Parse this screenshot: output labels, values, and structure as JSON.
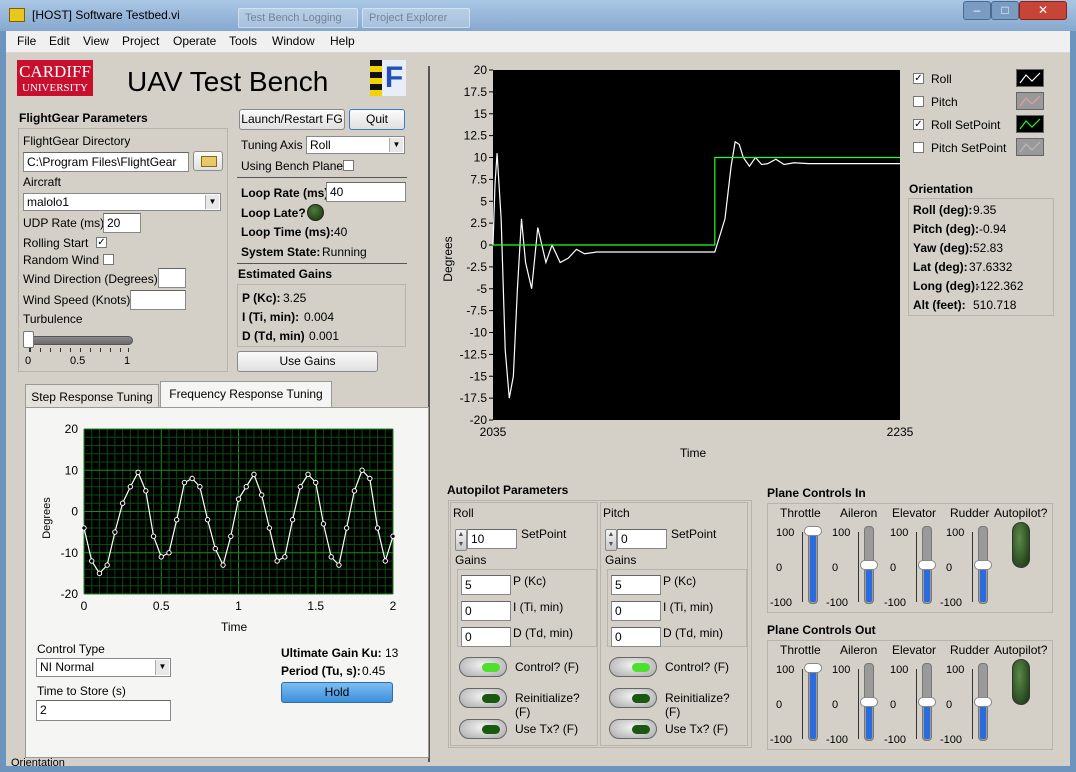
{
  "window": {
    "title": "[HOST] Software Testbed.vi",
    "ghost_tabs": [
      "Test Bench Logging",
      "Project Explorer"
    ]
  },
  "menu": [
    "File",
    "Edit",
    "View",
    "Project",
    "Operate",
    "Tools",
    "Window",
    "Help"
  ],
  "header": {
    "logo_line1": "CARDIFF",
    "logo_line2": "UNIVERSITY",
    "title": "UAV Test Bench",
    "fg_logo": "F"
  },
  "fg_params": {
    "section_title": "FlightGear Parameters",
    "dir_label": "FlightGear Directory",
    "dir_value": "C:\\Program Files\\FlightGear",
    "aircraft_label": "Aircraft",
    "aircraft_value": "malolo1",
    "udp_label": "UDP Rate (ms)",
    "udp_value": "20",
    "rolling_label": "Rolling Start",
    "rolling_checked": true,
    "random_wind_label": "Random Wind",
    "random_wind_checked": false,
    "wind_dir_label": "Wind Direction (Degrees)",
    "wind_dir_value": "",
    "wind_speed_label": "Wind Speed (Knots)",
    "wind_speed_value": "",
    "turbulence_label": "Turbulence",
    "turbulence_ticks": [
      "0",
      "0.5",
      "1"
    ],
    "turbulence_value": 0
  },
  "controls": {
    "launch_label": "Launch/Restart FG",
    "quit_label": "Quit",
    "tuning_axis_label": "Tuning Axis",
    "tuning_axis_value": "Roll",
    "bench_plane_label": "Using Bench Plane",
    "bench_plane_checked": false,
    "loop_rate_label": "Loop Rate (ms)",
    "loop_rate_value": "40",
    "loop_late_label": "Loop Late?",
    "loop_time_label": "Loop Time (ms):",
    "loop_time_value": "40",
    "system_state_label": "System State:",
    "system_state_value": "Running",
    "est_gains_title": "Estimated Gains",
    "p_label": "P (Kc):",
    "p_value": "3.25",
    "i_label": "I (Ti, min):",
    "i_value": "0.004",
    "d_label": "D (Td, min)",
    "d_value": "0.001",
    "use_gains_label": "Use Gains"
  },
  "main_chart": {
    "ylabel": "Degrees",
    "xlabel": "Time",
    "x_tick_labels": [
      "2035",
      "2235"
    ],
    "y_tick_labels": [
      "20",
      "17.5",
      "15",
      "12.5",
      "10",
      "7.5",
      "5",
      "2.5",
      "0",
      "-2.5",
      "-5",
      "-7.5",
      "-10",
      "-12.5",
      "-15",
      "-17.5",
      "-20"
    ]
  },
  "legend": [
    {
      "label": "Roll",
      "checked": true,
      "color": "#ffffff"
    },
    {
      "label": "Pitch",
      "checked": false,
      "color": "#e0a0a0"
    },
    {
      "label": "Roll SetPoint",
      "checked": true,
      "color": "#22ff22"
    },
    {
      "label": "Pitch SetPoint",
      "checked": false,
      "color": "#bbbbbb"
    }
  ],
  "orientation": {
    "title": "Orientation",
    "rows": [
      {
        "label": "Roll (deg):",
        "value": "9.35"
      },
      {
        "label": "Pitch (deg):",
        "value": "-0.94"
      },
      {
        "label": "Yaw (deg):",
        "value": "52.83"
      },
      {
        "label": "Lat (deg):",
        "value": "37.6332"
      },
      {
        "label": "Long (deg):",
        "value": "-122.362"
      },
      {
        "label": "Alt (feet):",
        "value": "510.718"
      }
    ]
  },
  "tabs": {
    "step_label": "Step Response Tuning",
    "freq_label": "Frequency Response Tuning"
  },
  "freq_chart": {
    "ylabel": "Degrees",
    "xlabel": "Time",
    "x_tick_labels": [
      "0",
      "0.5",
      "1",
      "1.5",
      "2"
    ],
    "y_tick_labels": [
      "20",
      "10",
      "0",
      "-10",
      "-20"
    ]
  },
  "freq_panel": {
    "control_type_label": "Control Type",
    "control_type_value": "NI Normal",
    "time_store_label": "Time to Store (s)",
    "time_store_value": "2",
    "ku_label": "Ultimate Gain Ku:",
    "ku_value": "13",
    "period_label": "Period (Tu, s):",
    "period_value": "0.45",
    "hold_label": "Hold",
    "bottom_cut_label": "Orientation"
  },
  "autopilot": {
    "title": "Autopilot Parameters",
    "setpoint_label": "SetPoint",
    "gains_label": "Gains",
    "p_label": "P (Kc)",
    "i_label": "I (Ti, min)",
    "d_label": "D (Td, min)",
    "control_label": "Control? (F)",
    "reinit_label": "Reinitialize? (F)",
    "usetx_label": "Use Tx? (F)",
    "roll": {
      "title": "Roll",
      "setpoint": "10",
      "p": "5",
      "i": "0",
      "d": "0",
      "control_on": true
    },
    "pitch": {
      "title": "Pitch",
      "setpoint": "0",
      "p": "5",
      "i": "0",
      "d": "0",
      "control_on": true
    }
  },
  "plane_in": {
    "title": "Plane Controls In",
    "labels": [
      "Throttle",
      "Aileron",
      "Elevator",
      "Rudder",
      "Autopilot?"
    ],
    "scale": [
      "100",
      "0",
      "-100"
    ],
    "values": [
      100,
      0,
      0,
      0
    ]
  },
  "plane_out": {
    "title": "Plane Controls Out",
    "labels": [
      "Throttle",
      "Aileron",
      "Elevator",
      "Rudder",
      "Autopilot?"
    ],
    "scale": [
      "100",
      "0",
      "-100"
    ],
    "values": [
      100,
      0,
      0,
      0
    ]
  },
  "chart_data": [
    {
      "type": "line",
      "xlabel": "Time",
      "ylabel": "Degrees",
      "xlim": [
        2035,
        2235
      ],
      "ylim": [
        -20,
        20
      ],
      "series": [
        {
          "name": "Roll",
          "x": [
            2035,
            2036,
            2037,
            2039,
            2041,
            2043,
            2045,
            2047,
            2049,
            2051,
            2054,
            2057,
            2061,
            2064,
            2068,
            2072,
            2076,
            2080,
            2086,
            2100,
            2120,
            2144,
            2149,
            2152,
            2154,
            2156,
            2158,
            2161,
            2164,
            2167,
            2170,
            2174,
            2178,
            2183,
            2190,
            2200,
            2235
          ],
          "y": [
            0,
            7,
            10.5,
            3,
            -12,
            -17.5,
            -15,
            -5,
            3,
            -2,
            -5,
            2,
            -2,
            0,
            -2,
            -1.5,
            -0.5,
            -1,
            -0.8,
            -0.8,
            -0.8,
            -0.8,
            3,
            9,
            11.8,
            11.5,
            10,
            9,
            10,
            9.2,
            9.3,
            9.8,
            9.2,
            9.4,
            9.3,
            9.3,
            9.3
          ]
        },
        {
          "name": "Roll SetPoint",
          "x": [
            2035,
            2144,
            2144,
            2235
          ],
          "y": [
            0,
            0,
            10,
            10
          ]
        }
      ]
    },
    {
      "type": "line",
      "xlabel": "Time",
      "ylabel": "Degrees",
      "xlim": [
        0,
        2
      ],
      "ylim": [
        -20,
        20
      ],
      "series": [
        {
          "name": "",
          "x": [
            0,
            0.05,
            0.1,
            0.15,
            0.2,
            0.25,
            0.3,
            0.35,
            0.4,
            0.45,
            0.5,
            0.55,
            0.6,
            0.65,
            0.7,
            0.75,
            0.8,
            0.85,
            0.9,
            0.95,
            1.0,
            1.05,
            1.1,
            1.15,
            1.2,
            1.25,
            1.3,
            1.35,
            1.4,
            1.45,
            1.5,
            1.55,
            1.6,
            1.65,
            1.7,
            1.75,
            1.8,
            1.85,
            1.9,
            1.95,
            2.0
          ],
          "y": [
            -4,
            -12,
            -15,
            -13,
            -5,
            2,
            6,
            9.5,
            5,
            -6,
            -11,
            -10,
            -2,
            7,
            8,
            6,
            -2,
            -9,
            -13,
            -6,
            3,
            6,
            9,
            4,
            -4,
            -12,
            -11,
            -2,
            6,
            9,
            7,
            -3,
            -11,
            -13,
            -4,
            5,
            10,
            8,
            -4,
            -12,
            -6
          ]
        }
      ]
    }
  ]
}
